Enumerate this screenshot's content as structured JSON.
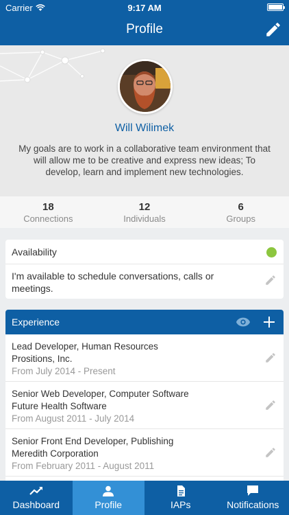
{
  "status_bar": {
    "carrier": "Carrier",
    "time": "9:17 AM"
  },
  "nav": {
    "title": "Profile",
    "edit_icon": "pencil-icon"
  },
  "profile": {
    "name": "Will Wilimek",
    "bio": "My goals are to work in a collaborative team environment that will allow me to be creative and express new ideas; To develop, learn and implement new technologies."
  },
  "stats": [
    {
      "value": "18",
      "label": "Connections"
    },
    {
      "value": "12",
      "label": "Individuals"
    },
    {
      "value": "6",
      "label": "Groups"
    }
  ],
  "availability": {
    "title": "Availability",
    "status_color": "#8cc63f",
    "text": "I'm available to schedule conversations, calls or meetings."
  },
  "experience": {
    "title": "Experience",
    "items": [
      {
        "role": "Lead Developer, Human Resources",
        "company": "Prositions, Inc.",
        "dates": "From July 2014 - Present"
      },
      {
        "role": "Senior Web Developer, Computer Software",
        "company": "Future Health Software",
        "dates": "From August 2011 - July 2014"
      },
      {
        "role": "Senior Front End Developer, Publishing",
        "company": "Meredith Corporation",
        "dates": "From February 2011 - August 2011"
      }
    ]
  },
  "tabs": [
    {
      "label": "Dashboard",
      "icon": "trend-icon"
    },
    {
      "label": "Profile",
      "icon": "person-icon"
    },
    {
      "label": "IAPs",
      "icon": "document-icon"
    },
    {
      "label": "Notifications",
      "icon": "chat-icon"
    }
  ],
  "colors": {
    "primary": "#0e5fa4",
    "active_tab": "#3390d6",
    "available": "#8cc63f"
  }
}
